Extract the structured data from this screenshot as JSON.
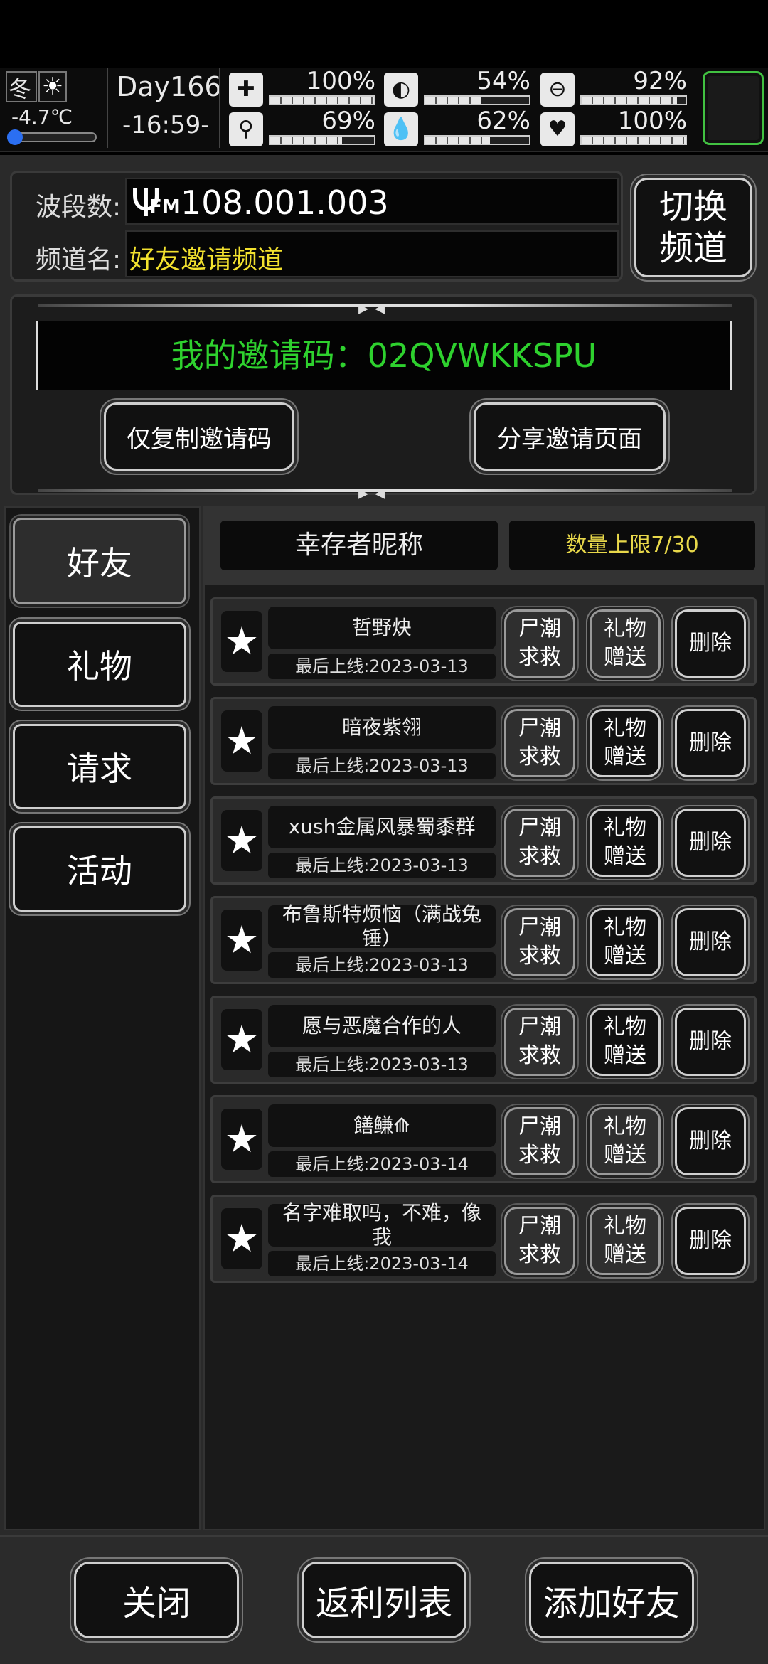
{
  "status": {
    "season": "冬",
    "temperature": "-4.7℃",
    "day": "Day166",
    "time": "-16:59-",
    "stats": [
      {
        "icon": "medkit-icon",
        "glyph": "✚",
        "pct_text": "100%",
        "value": 1.0
      },
      {
        "icon": "stomach-icon",
        "glyph": "◐",
        "pct_text": "54%",
        "value": 0.54
      },
      {
        "icon": "energy-capsule-icon",
        "glyph": "⊖",
        "pct_text": "92%",
        "value": 0.92
      },
      {
        "icon": "foot-icon",
        "glyph": "⚲",
        "pct_text": "69%",
        "value": 0.69
      },
      {
        "icon": "water-drop-icon",
        "glyph": "💧",
        "pct_text": "62%",
        "value": 0.62
      },
      {
        "icon": "heart-icon",
        "glyph": "♥",
        "pct_text": "100%",
        "value": 1.0
      }
    ]
  },
  "radio": {
    "band_label": "波段数:",
    "band_value": "108.001.003",
    "fm_tag": "FM",
    "channel_label": "频道名:",
    "channel_value": "好友邀请频道",
    "switch_label": "切换频道"
  },
  "invite": {
    "code_text": "我的邀请码：02QVWKKSPU",
    "copy_button": "仅复制邀请码",
    "share_button": "分享邀请页面"
  },
  "sidebar": {
    "items": [
      {
        "label": "好友",
        "active": true
      },
      {
        "label": "礼物",
        "active": false
      },
      {
        "label": "请求",
        "active": false
      },
      {
        "label": "活动",
        "active": false
      }
    ]
  },
  "list_header": {
    "nickname_col": "幸存者昵称",
    "limit_text": "数量上限7/30"
  },
  "friends": [
    {
      "name": "哲野炔",
      "last_online": "最后上线:2023-03-13",
      "gift_active": false
    },
    {
      "name": "暗夜紫翎",
      "last_online": "最后上线:2023-03-13",
      "gift_active": true
    },
    {
      "name": "xush金属风暴蜀黍群",
      "last_online": "最后上线:2023-03-13",
      "gift_active": true
    },
    {
      "name": "布鲁斯特烦恼（满战兔锤）",
      "last_online": "最后上线:2023-03-13",
      "gift_active": true
    },
    {
      "name": "愿与恶魔合作的人",
      "last_online": "最后上线:2023-03-13",
      "gift_active": true
    },
    {
      "name": "饍鳒⟰",
      "last_online": "最后上线:2023-03-14",
      "gift_active": false
    },
    {
      "name": "名字难取吗，不难，像我",
      "last_online": "最后上线:2023-03-14",
      "gift_active": false
    }
  ],
  "row_buttons": {
    "zombie_help": "尸潮求救",
    "gift_send": "礼物赠送",
    "delete": "删除"
  },
  "footer": {
    "close": "关闭",
    "rebate_list": "返利列表",
    "add_friend": "添加好友"
  },
  "colors": {
    "invite_green": "#2ed12e",
    "channel_yellow": "#f2e12e",
    "limit_yellow": "#e8d84a"
  }
}
